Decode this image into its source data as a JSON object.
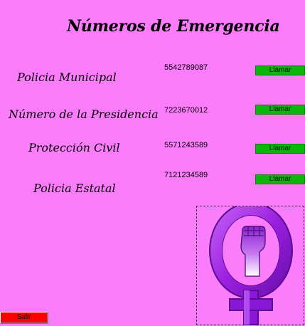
{
  "header": {
    "title": "Números de Emergencia"
  },
  "contacts": [
    {
      "label": "Policia Municipal",
      "phone": "5542789087",
      "button": "Llamar"
    },
    {
      "label": "Número de la  Presidencia",
      "phone": "7223670012",
      "button": "Llamar"
    },
    {
      "label": "Protección Civil",
      "phone": "5571243589",
      "button": "Llamar"
    },
    {
      "label": "Policia Estatal",
      "phone": "7121234589",
      "button": "Llamar"
    }
  ],
  "footer": {
    "exit_label": "Salir"
  },
  "logo": {
    "icon": "feminist-fist-venus-symbol-icon"
  },
  "colors": {
    "background": "#fb7dfb",
    "call_button": "#0ab60a",
    "exit_button": "#ff0000",
    "logo_purple": "#9b1fe0"
  }
}
